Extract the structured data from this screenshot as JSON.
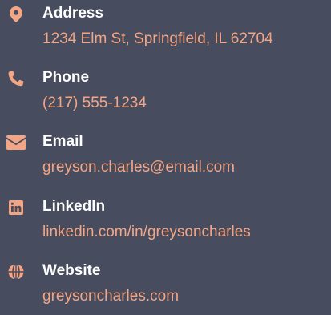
{
  "accent_color": "#f4a584",
  "background_color": "#474c5e",
  "contacts": [
    {
      "icon": "map-marker-icon",
      "label": "Address",
      "value": "1234 Elm St, Springfield, IL 62704"
    },
    {
      "icon": "phone-icon",
      "label": "Phone",
      "value": "(217) 555-1234"
    },
    {
      "icon": "envelope-icon",
      "label": "Email",
      "value": "greyson.charles@email.com"
    },
    {
      "icon": "linkedin-icon",
      "label": "LinkedIn",
      "value": "linkedin.com/in/greysoncharles"
    },
    {
      "icon": "globe-icon",
      "label": "Website",
      "value": "greysoncharles.com"
    }
  ]
}
